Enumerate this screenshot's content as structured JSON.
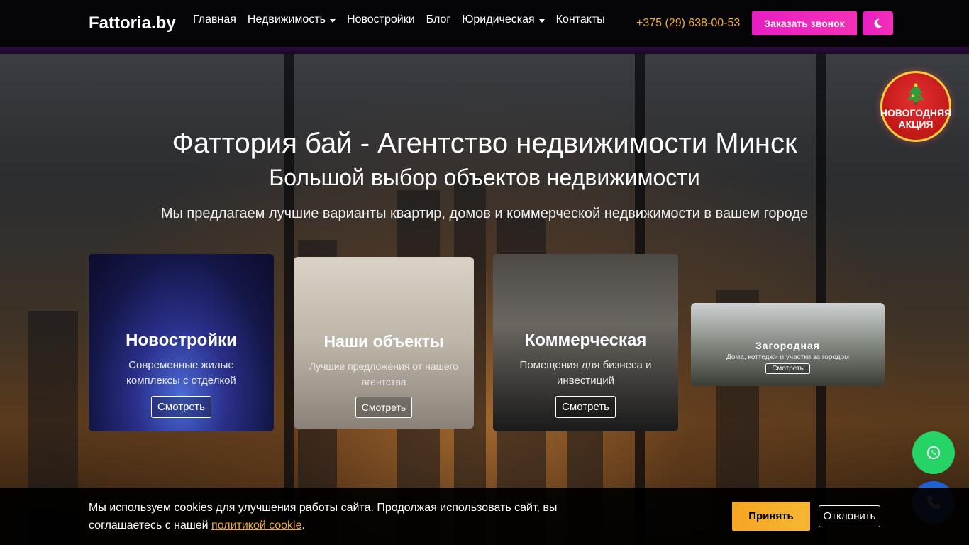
{
  "brand": "Fattoria.by",
  "nav": {
    "items": [
      {
        "label": "Главная",
        "dropdown": false
      },
      {
        "label": "Недвижимость",
        "dropdown": true
      },
      {
        "label": "Новостройки",
        "dropdown": false
      },
      {
        "label": "Блог",
        "dropdown": false
      },
      {
        "label": "Юридическая",
        "dropdown": true
      },
      {
        "label": "Контакты",
        "dropdown": false
      }
    ],
    "phone": "+375 (29) 638-00-53",
    "call_button": "Заказать звонок",
    "theme_icon": "moon-icon"
  },
  "hero": {
    "title": "Фаттория бай - Агентство недвижимости Минск",
    "subtitle": "Большой выбор объектов недвижимости",
    "text": "Мы предлагаем лучшие варианты квартир, домов и коммерческой недвижимости в вашем городе"
  },
  "cards": [
    {
      "title": "Новостройки",
      "desc": "Современные жилые комплексы с отделкой",
      "button": "Смотреть"
    },
    {
      "title": "Наши объекты",
      "desc": "Лучшие предложения от нашего агентства",
      "button": "Смотреть"
    },
    {
      "title": "Коммерческая",
      "desc": "Помещения для бизнеса и инвестиций",
      "button": "Смотреть"
    },
    {
      "title": "Загородная",
      "desc": "Дома, коттеджи и участки за городом",
      "button": "Смотреть"
    }
  ],
  "promo": {
    "line1": "НОВОГОДНЯЯ",
    "line2": "АКЦИЯ",
    "icon": "christmas-tree-icon"
  },
  "cookie": {
    "text_before": "Мы используем cookies для улучшения работы сайта. Продолжая использовать сайт, вы соглашаетесь с нашей ",
    "link": "политикой cookie",
    "text_after": ".",
    "accept": "Принять",
    "decline": "Отклонить"
  },
  "colors": {
    "accent": "#f330b7",
    "phone": "#f2a93b",
    "whatsapp": "#25d366",
    "call": "#1d63d8"
  }
}
